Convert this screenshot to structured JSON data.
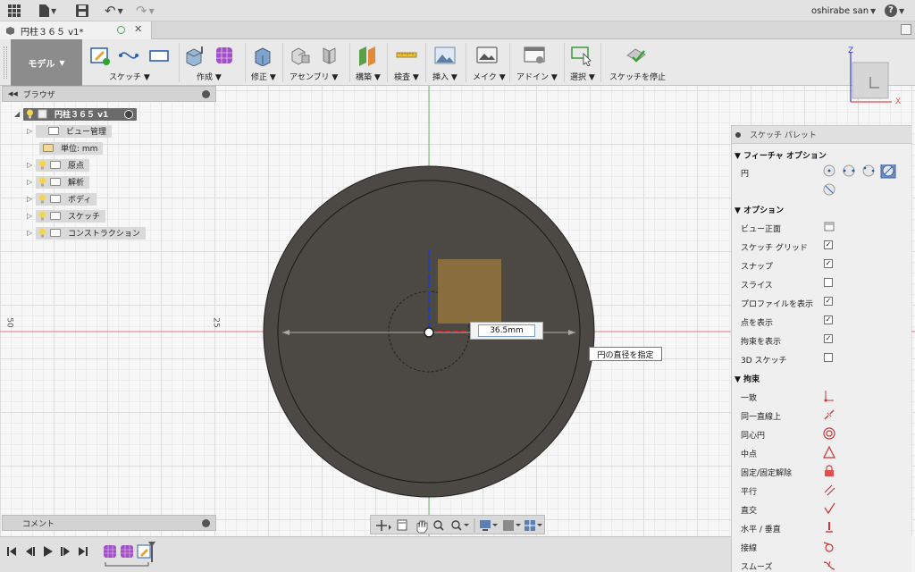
{
  "topbar": {
    "user": "oshirabe san",
    "help": "?"
  },
  "tab": {
    "title": "円柱３６５ v1*"
  },
  "ribbon": {
    "model_label": "モデル",
    "groups": [
      "スケッチ",
      "作成",
      "修正",
      "アセンブリ",
      "構築",
      "検査",
      "挿入",
      "メイク",
      "アドイン",
      "選択",
      "スケッチを停止"
    ]
  },
  "browser": {
    "title": "ブラウザ",
    "root": "円柱３６５ v1",
    "items": [
      {
        "label": "ビュー管理"
      },
      {
        "label": "単位: mm"
      },
      {
        "label": "原点"
      },
      {
        "label": "解析"
      },
      {
        "label": "ボディ"
      },
      {
        "label": "スケッチ"
      },
      {
        "label": "コンストラクション"
      }
    ]
  },
  "comment": {
    "label": "コメント"
  },
  "canvas": {
    "ruler_50": "50",
    "ruler_25": "25",
    "dimension_value": "36.5mm",
    "tooltip": "円の直径を指定",
    "colors": {
      "disk": "#4c4844",
      "square": "#8a6d3d",
      "axis_green": "#6bbf6b",
      "axis_red": "#e07878",
      "blue_axis": "#1a3fc8"
    }
  },
  "viewcube": {
    "z": "Z",
    "x": "X"
  },
  "palette": {
    "title": "スケッチ パレット",
    "feature_section": "フィーチャ オプション",
    "circle_label": "円",
    "options_section": "オプション",
    "options": [
      {
        "label": "ビュー正面",
        "checked": null
      },
      {
        "label": "スケッチ グリッド",
        "checked": true
      },
      {
        "label": "スナップ",
        "checked": true
      },
      {
        "label": "スライス",
        "checked": false
      },
      {
        "label": "プロファイルを表示",
        "checked": true
      },
      {
        "label": "点を表示",
        "checked": true
      },
      {
        "label": "拘束を表示",
        "checked": true
      },
      {
        "label": "3D スケッチ",
        "checked": false
      }
    ],
    "constraints_section": "拘束",
    "constraints": [
      {
        "label": "一致",
        "icon": "coincident-icon"
      },
      {
        "label": "同一直線上",
        "icon": "collinear-icon"
      },
      {
        "label": "同心円",
        "icon": "concentric-icon"
      },
      {
        "label": "中点",
        "icon": "midpoint-icon"
      },
      {
        "label": "固定/固定解除",
        "icon": "lock-icon"
      },
      {
        "label": "平行",
        "icon": "parallel-icon"
      },
      {
        "label": "直交",
        "icon": "perpendicular-icon"
      },
      {
        "label": "水平 / 垂直",
        "icon": "horizontal-vertical-icon"
      },
      {
        "label": "接線",
        "icon": "tangent-icon"
      },
      {
        "label": "スムーズ",
        "icon": "smooth-icon"
      }
    ]
  }
}
